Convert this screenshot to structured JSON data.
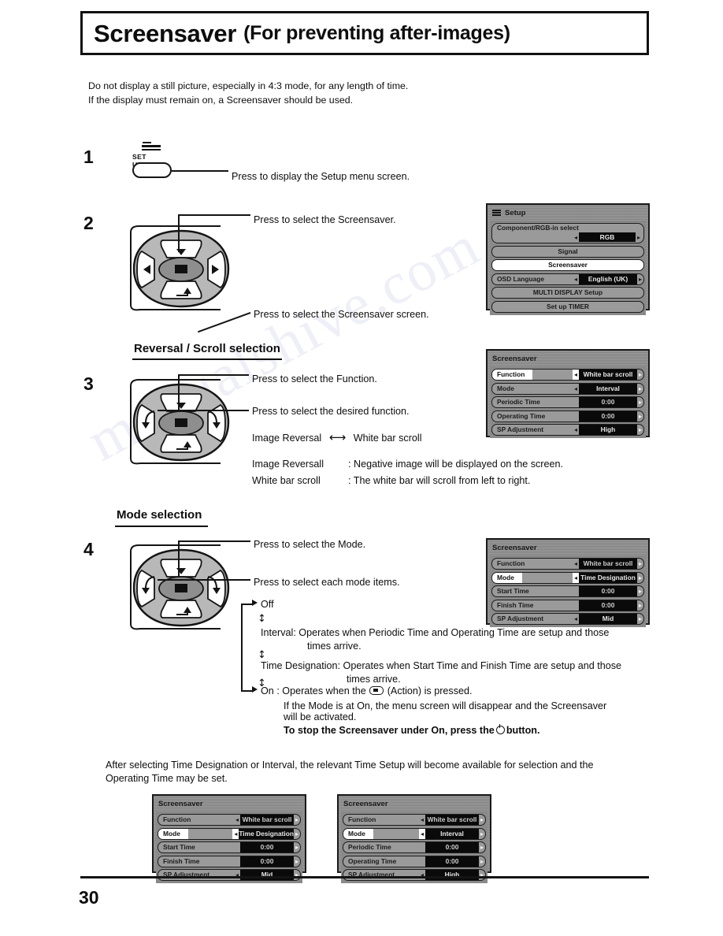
{
  "header": {
    "title": "Screensaver",
    "subtitle": "(For preventing after-images)"
  },
  "intro": {
    "line1": "Do not display a still picture, especially in 4:3 mode, for any length of time.",
    "line2": "If the display must remain on, a Screensaver should be used."
  },
  "steps": {
    "one": {
      "number": "1",
      "button_label": "SET UP",
      "callout": "Press to display the Setup menu screen."
    },
    "two": {
      "number": "2",
      "callout_top": "Press to select the Screensaver.",
      "callout_bottom": "Press to select the Screensaver screen."
    },
    "three": {
      "number": "3",
      "section_title": "Reversal / Scroll selection",
      "callout_top": "Press to select the Function.",
      "callout_bottom": "Press to select the desired function.",
      "toggle_left": "Image Reversal",
      "toggle_arrow": "⟷",
      "toggle_right": "White bar scroll",
      "desc1_term": "Image Reversall",
      "desc1_text": ": Negative image will be displayed on the screen.",
      "desc2_term": "White bar scroll",
      "desc2_text": ": The white bar will scroll from left to right."
    },
    "four": {
      "number": "4",
      "section_title": "Mode selection",
      "callout_top": "Press to select the Mode.",
      "callout_bottom": "Press to select each mode items."
    }
  },
  "mode_flow": {
    "off": "Off",
    "interval_term": "Interval",
    "interval_text": ": Operates when Periodic Time and Operating Time are setup and those",
    "interval_text2": "times arrive.",
    "timedesignation_term": "Time Designation",
    "timedesignation_text": ": Operates when Start Time and Finish Time are setup and those",
    "timedesignation_text2": "times arrive.",
    "on_term": "On",
    "on_text_a": ": Operates when the",
    "on_text_b": "(Action) is pressed.",
    "on_note1": "If the Mode is at On, the menu screen will disappear and the Screensaver",
    "on_note2": "will be activated.",
    "on_note3_a": "To stop the Screensaver under On, press the",
    "on_note3_b": "button."
  },
  "closing": {
    "line1": "After selecting Time Designation or Interval, the relevant Time Setup will become available for selection and the",
    "line2": "Operating Time may be set."
  },
  "osd_setup": {
    "title": "Setup",
    "rows": [
      {
        "label": "Component/RGB-in  select",
        "value": "RGB",
        "type": "split2",
        "arrows": true
      },
      {
        "label": "Signal",
        "type": "center"
      },
      {
        "label": "Screensaver",
        "type": "center",
        "selected": true
      },
      {
        "label": "OSD  Language",
        "value": "English (UK)",
        "type": "value",
        "arrows": true
      },
      {
        "label": "MULTI DISPLAY Setup",
        "type": "center"
      },
      {
        "label": "Set up TIMER",
        "type": "center"
      }
    ]
  },
  "osd_screensaver_interval": {
    "title": "Screensaver",
    "rows": [
      {
        "label": "Function",
        "value": "White bar scroll",
        "highlight": true,
        "arrows": true
      },
      {
        "label": "Mode",
        "value": "Interval",
        "arrows": true
      },
      {
        "label": "Periodic Time",
        "value": "0:00",
        "arrows": false
      },
      {
        "label": "Operating Time",
        "value": "0:00",
        "arrows": false
      },
      {
        "label": "SP Adjustment",
        "value": "High",
        "arrows": true
      }
    ]
  },
  "osd_screensaver_timedesignation": {
    "title": "Screensaver",
    "rows": [
      {
        "label": "Function",
        "value": "White bar scroll",
        "arrows": true
      },
      {
        "label": "Mode",
        "value": "Time Designation",
        "highlight": true,
        "arrows": true
      },
      {
        "label": "Start Time",
        "value": "0:00",
        "arrows": false
      },
      {
        "label": "Finish Time",
        "value": "0:00",
        "arrows": false
      },
      {
        "label": "SP Adjustment",
        "value": "Mid",
        "arrows": true
      }
    ]
  },
  "osd_bottom_left": {
    "title": "Screensaver",
    "rows": [
      {
        "label": "Function",
        "value": "White bar scroll",
        "arrows": true
      },
      {
        "label": "Mode",
        "value": "Time Designation",
        "highlight": true,
        "arrows": true
      },
      {
        "label": "Start Time",
        "value": "0:00",
        "arrows": false
      },
      {
        "label": "Finish Time",
        "value": "0:00",
        "arrows": false
      },
      {
        "label": "SP Adjustment",
        "value": "Mid",
        "arrows": true
      }
    ]
  },
  "osd_bottom_right": {
    "title": "Screensaver",
    "rows": [
      {
        "label": "Function",
        "value": "White bar scroll",
        "arrows": true
      },
      {
        "label": "Mode",
        "value": "Interval",
        "highlight": true,
        "arrows": true
      },
      {
        "label": "Periodic Time",
        "value": "0:00",
        "arrows": false
      },
      {
        "label": "Operating Time",
        "value": "0:00",
        "arrows": false
      },
      {
        "label": "SP Adjustment",
        "value": "High",
        "arrows": true
      }
    ]
  },
  "footer": {
    "page_number": "30"
  },
  "watermark": {
    "text": "manualshive.com"
  },
  "colors": {
    "ink": "#0d0d0d",
    "osd_bg": "#8e8e8e",
    "osd_value_bg": "#0a0a0a",
    "osd_selected": "#ffffff"
  }
}
